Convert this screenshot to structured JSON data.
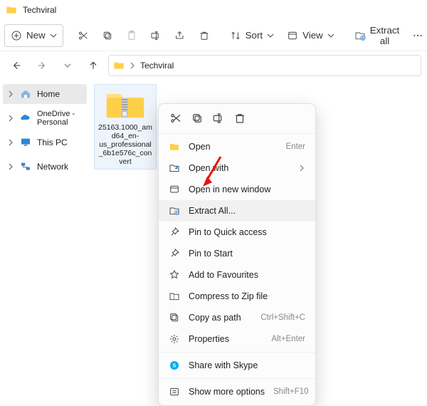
{
  "window": {
    "title": "Techviral"
  },
  "toolbar": {
    "new_label": "New",
    "sort_label": "Sort",
    "view_label": "View",
    "extract_all_label": "Extract all"
  },
  "breadcrumb": {
    "current": "Techviral"
  },
  "sidebar": {
    "items": [
      {
        "label": "Home"
      },
      {
        "label": "OneDrive - Personal"
      },
      {
        "label": "This PC"
      },
      {
        "label": "Network"
      }
    ]
  },
  "file": {
    "name": "25163.1000_amd64_en-us_professional_6b1e576c_convert"
  },
  "context_menu": {
    "open": {
      "label": "Open",
      "accel": "Enter"
    },
    "open_with": {
      "label": "Open with"
    },
    "open_new_window": {
      "label": "Open in new window"
    },
    "extract_all": {
      "label": "Extract All..."
    },
    "pin_quick": {
      "label": "Pin to Quick access"
    },
    "pin_start": {
      "label": "Pin to Start"
    },
    "add_fav": {
      "label": "Add to Favourites"
    },
    "compress": {
      "label": "Compress to Zip file"
    },
    "copy_path": {
      "label": "Copy as path",
      "accel": "Ctrl+Shift+C"
    },
    "properties": {
      "label": "Properties",
      "accel": "Alt+Enter"
    },
    "share_skype": {
      "label": "Share with Skype"
    },
    "more_options": {
      "label": "Show more options",
      "accel": "Shift+F10"
    }
  }
}
